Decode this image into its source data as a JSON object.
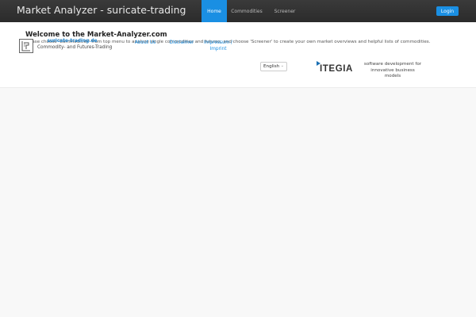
{
  "header": {
    "title": "Market Analyzer - suricate-trading",
    "tabs": [
      {
        "label": "Home"
      },
      {
        "label": "Commodities"
      },
      {
        "label": "Screener"
      }
    ],
    "login_label": "Login"
  },
  "welcome": {
    "title": "Welcome to the Market-Analyzer.com",
    "text": "Please choose 'Commodities' from top menu to analyze single commodities and futures, and choose 'Screener' to create your own market overviews and helpful lists of commodities."
  },
  "footer": {
    "brand_link": "suricate-trading.de",
    "brand_subtitle": "Commodity- and Futures-Trading",
    "links": {
      "about": "About Us",
      "disclaimer": "Disclaimer",
      "impressum_line1": "Impressum /",
      "impressum_line2": "Imprint"
    },
    "language": "English",
    "partner_logo_text": "ITEGIA",
    "partner_text": "software development for innovative business models"
  },
  "colors": {
    "accent": "#1a8fe3",
    "navbar": "#333333",
    "background": "#f8f8f8"
  },
  "icons": {
    "logo": "suricate-logo-icon",
    "partner": "itegia-logo-icon",
    "dropdown": "chevron-down-icon"
  }
}
